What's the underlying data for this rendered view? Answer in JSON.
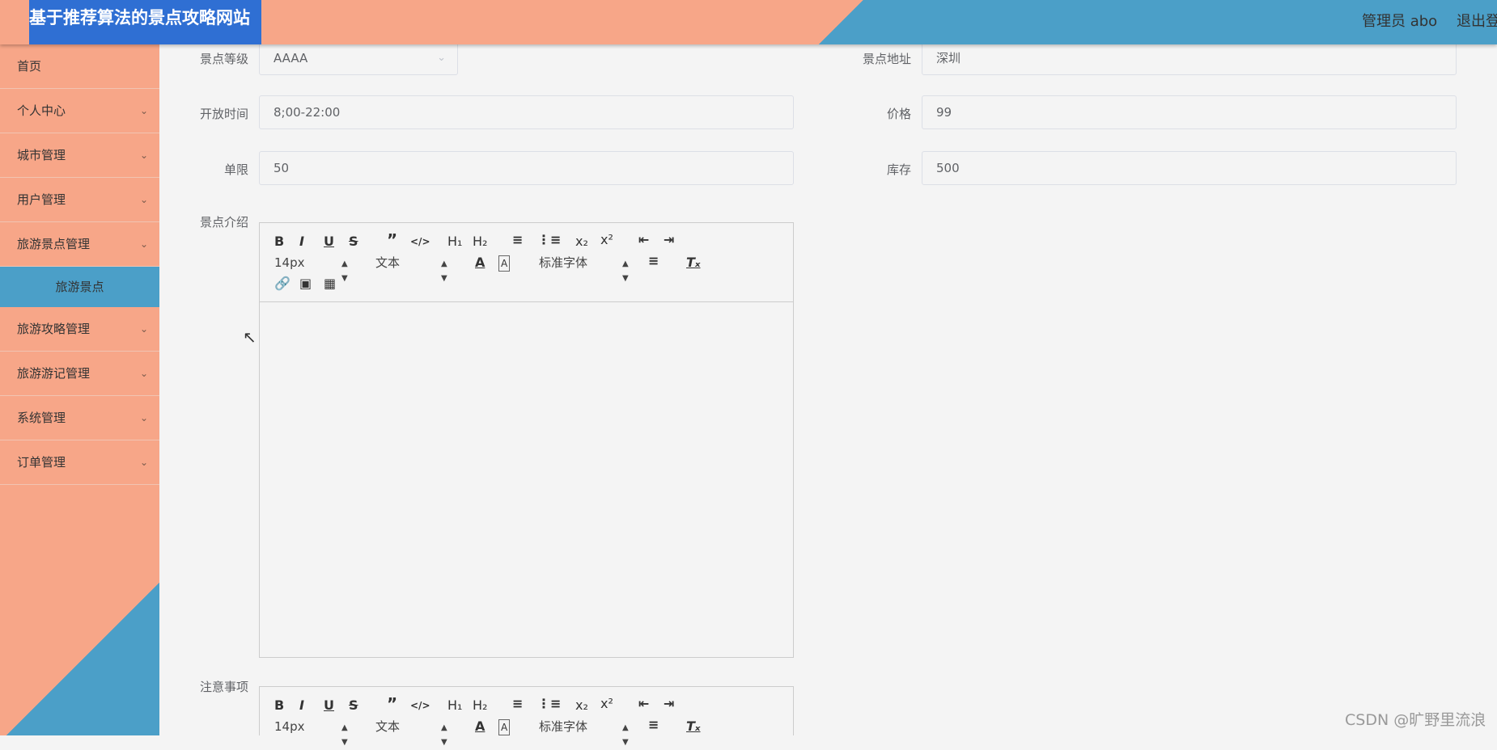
{
  "header": {
    "site_title": "基于推荐算法的景点攻略网站",
    "user_label": "管理员 abo",
    "logout_label": "退出登录"
  },
  "sidebar": {
    "items": [
      {
        "label": "首页"
      },
      {
        "label": "个人中心"
      },
      {
        "label": "城市管理"
      },
      {
        "label": "用户管理"
      },
      {
        "label": "旅游景点管理"
      },
      {
        "label": "旅游攻略管理"
      },
      {
        "label": "旅游游记管理"
      },
      {
        "label": "系统管理"
      },
      {
        "label": "订单管理"
      }
    ],
    "sub_item": "旅游景点"
  },
  "form": {
    "level": {
      "label": "景点等级",
      "value": "AAAA"
    },
    "address": {
      "label": "景点地址",
      "value": "深圳"
    },
    "open_time": {
      "label": "开放时间",
      "value": "8;00-22:00"
    },
    "price": {
      "label": "价格",
      "value": "99"
    },
    "limit": {
      "label": "单限",
      "value": "50"
    },
    "stock": {
      "label": "库存",
      "value": "500"
    },
    "intro": {
      "label": "景点介绍"
    },
    "notes": {
      "label": "注意事项"
    }
  },
  "editor": {
    "size_value": "14px",
    "header_value": "文本",
    "font_value": "标准字体"
  },
  "watermark": "CSDN @旷野里流浪"
}
